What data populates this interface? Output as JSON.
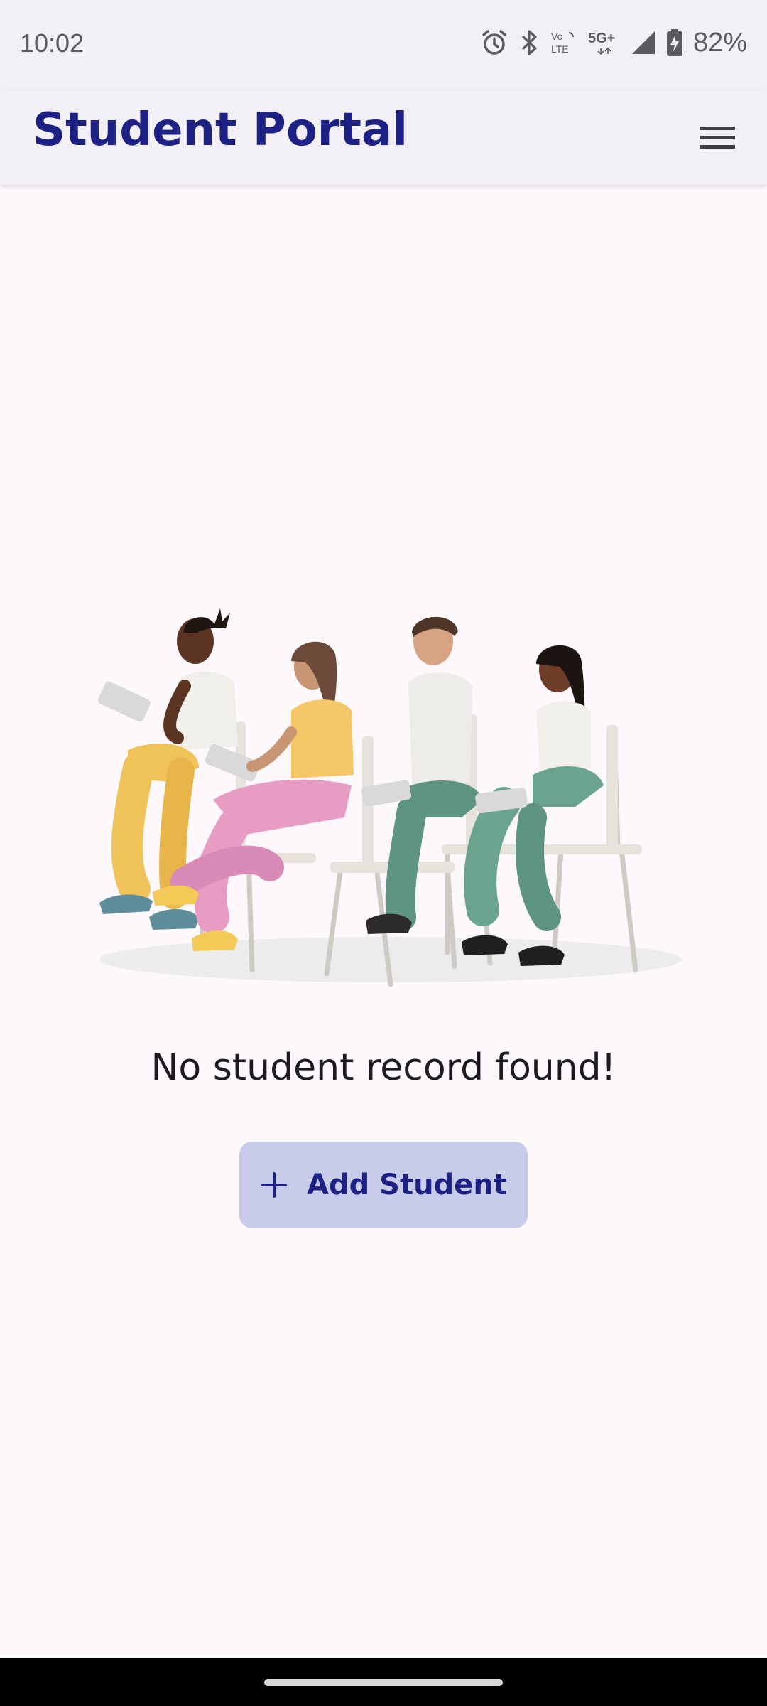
{
  "status_bar": {
    "time": "10:02",
    "battery": "82%",
    "icons": [
      "alarm-icon",
      "bluetooth-icon",
      "volte-icon",
      "5g-plus-icon",
      "signal-icon",
      "battery-charging-icon"
    ]
  },
  "app_bar": {
    "title": "Student Portal",
    "menu_icon": "hamburger-menu-icon"
  },
  "empty_state": {
    "illustration": "students-sitting-on-chairs-illustration",
    "message": "No student record found!"
  },
  "add_button": {
    "icon": "plus-icon",
    "label": "Add Student"
  },
  "colors": {
    "primary": "#1d2184",
    "button_bg": "#c8cbe9",
    "app_bar_bg": "#f2eff7",
    "page_bg": "#fdf8fc"
  }
}
